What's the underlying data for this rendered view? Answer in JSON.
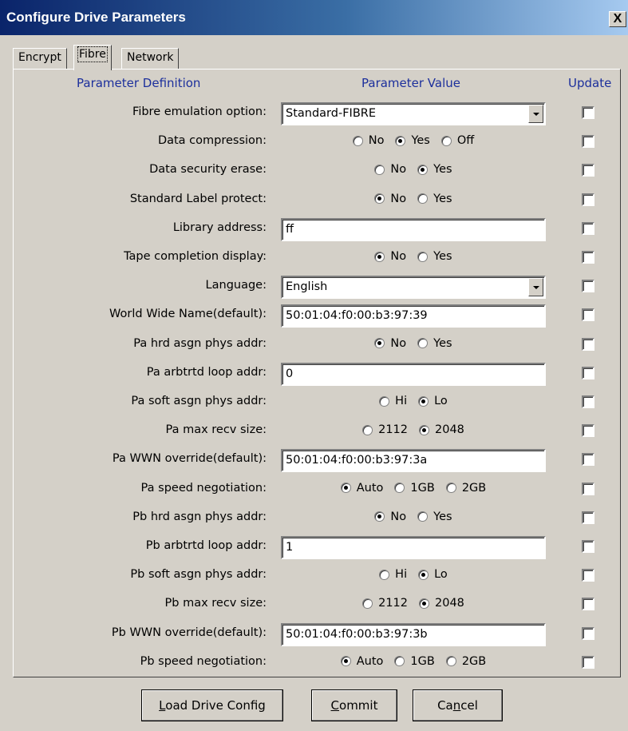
{
  "window": {
    "title": "Configure Drive Parameters",
    "close_glyph": "X"
  },
  "tabs": [
    "Encrypt",
    "Fibre",
    "Network"
  ],
  "active_tab": "Fibre",
  "headers": {
    "definition": "Parameter Definition",
    "value": "Parameter Value",
    "update": "Update"
  },
  "params": [
    {
      "label": "Fibre emulation option:",
      "type": "select",
      "value": "Standard-FIBRE"
    },
    {
      "label": "Data compression:",
      "type": "radio",
      "options": [
        "No",
        "Yes",
        "Off"
      ],
      "selected": "Yes"
    },
    {
      "label": "Data security erase:",
      "type": "radio",
      "options": [
        "No",
        "Yes"
      ],
      "selected": "Yes"
    },
    {
      "label": "Standard Label protect:",
      "type": "radio",
      "options": [
        "No",
        "Yes"
      ],
      "selected": "No"
    },
    {
      "label": "Library address:",
      "type": "text",
      "value": "ff"
    },
    {
      "label": "Tape completion display:",
      "type": "radio",
      "options": [
        "No",
        "Yes"
      ],
      "selected": "No"
    },
    {
      "label": "Language:",
      "type": "select",
      "value": "English"
    },
    {
      "label": "World Wide Name(default):",
      "type": "text",
      "value": "50:01:04:f0:00:b3:97:39"
    },
    {
      "label": "Pa hrd asgn phys addr:",
      "type": "radio",
      "options": [
        "No",
        "Yes"
      ],
      "selected": "No"
    },
    {
      "label": "Pa arbtrtd loop addr:",
      "type": "text",
      "value": "0"
    },
    {
      "label": "Pa soft asgn phys addr:",
      "type": "radio",
      "options": [
        "Hi",
        "Lo"
      ],
      "selected": "Lo"
    },
    {
      "label": "Pa max recv size:",
      "type": "radio",
      "options": [
        "2112",
        "2048"
      ],
      "selected": "2048"
    },
    {
      "label": "Pa WWN override(default):",
      "type": "text",
      "value": "50:01:04:f0:00:b3:97:3a"
    },
    {
      "label": "Pa speed negotiation:",
      "type": "radio",
      "options": [
        "Auto",
        "1GB",
        "2GB"
      ],
      "selected": "Auto"
    },
    {
      "label": "Pb hrd asgn phys addr:",
      "type": "radio",
      "options": [
        "No",
        "Yes"
      ],
      "selected": "No"
    },
    {
      "label": "Pb arbtrtd loop addr:",
      "type": "text",
      "value": "1"
    },
    {
      "label": "Pb soft asgn phys addr:",
      "type": "radio",
      "options": [
        "Hi",
        "Lo"
      ],
      "selected": "Lo"
    },
    {
      "label": "Pb max recv size:",
      "type": "radio",
      "options": [
        "2112",
        "2048"
      ],
      "selected": "2048"
    },
    {
      "label": "Pb WWN override(default):",
      "type": "text",
      "value": "50:01:04:f0:00:b3:97:3b"
    },
    {
      "label": "Pb speed negotiation:",
      "type": "radio",
      "options": [
        "Auto",
        "1GB",
        "2GB"
      ],
      "selected": "Auto"
    }
  ],
  "buttons": {
    "load": {
      "text": "Load Drive Config",
      "mnemonic": "L"
    },
    "commit": {
      "text": "Commit",
      "mnemonic": "C"
    },
    "cancel": {
      "text": "Cancel",
      "mnemonic": "n"
    }
  },
  "icons": {
    "close": "close-icon",
    "dropdown": "chevron-down-icon"
  }
}
